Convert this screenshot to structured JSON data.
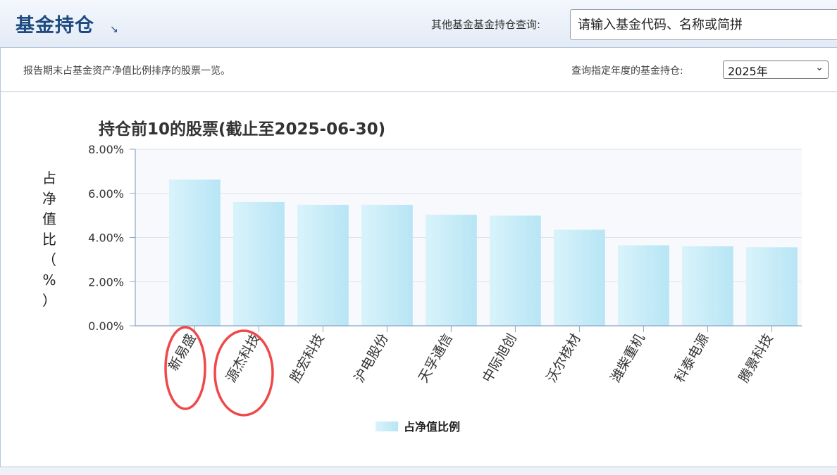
{
  "header": {
    "title": "基金持仓",
    "arrow_icon": "↘",
    "query_label": "其他基金基金持仓查询:",
    "search_placeholder": "请输入基金代码、名称或简拼"
  },
  "subbar": {
    "description": "报告期末占基金资产净值比例排序的股票一览。",
    "year_label": "查询指定年度的基金持仓:",
    "year_value": "2025年"
  },
  "chart_data": {
    "type": "bar",
    "title": "持仓前10的股票(截止至2025-06-30)",
    "xlabel": "",
    "ylabel": "占净值比（%）",
    "ylim": [
      0,
      8
    ],
    "yticks": [
      "0.00%",
      "2.00%",
      "4.00%",
      "6.00%",
      "8.00%"
    ],
    "grid": true,
    "legend": "bottom",
    "categories": [
      "新易盛",
      "源杰科技",
      "胜宏科技",
      "沪电股份",
      "天孚通信",
      "中际旭创",
      "沃尔核材",
      "潍柴重机",
      "科泰电源",
      "腾景科技"
    ],
    "series": [
      {
        "name": "占净值比例",
        "values": [
          6.62,
          5.61,
          5.48,
          5.48,
          5.03,
          4.99,
          4.35,
          3.65,
          3.6,
          3.56
        ]
      }
    ],
    "colors": {
      "bar_top": "#bfe9f6",
      "bar_bottom": "#dff4fb",
      "plot_bg": "#f7f9fc",
      "axis": "#8aa8c4",
      "annotation": "#f04848"
    }
  }
}
